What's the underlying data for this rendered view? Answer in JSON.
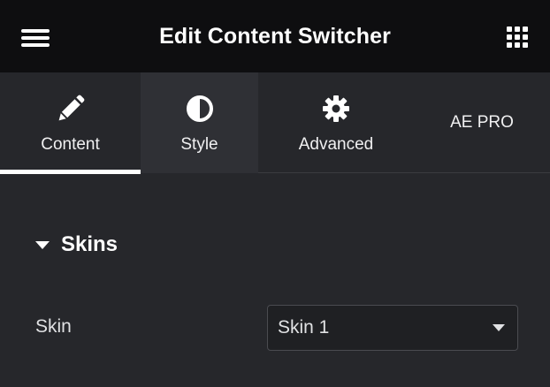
{
  "header": {
    "title": "Edit Content Switcher",
    "menu_icon": "hamburger-menu-icon",
    "apps_icon": "grid-apps-icon"
  },
  "tabs": [
    {
      "label": "Content",
      "icon": "pencil-icon",
      "active": true
    },
    {
      "label": "Style",
      "icon": "contrast-half-circle-icon",
      "active": false
    },
    {
      "label": "Advanced",
      "icon": "gear-icon",
      "active": false
    },
    {
      "label": "AE PRO",
      "icon": "",
      "active": false
    }
  ],
  "section": {
    "title": "Skins",
    "expanded": true
  },
  "controls": {
    "skin": {
      "label": "Skin",
      "value": "Skin 1"
    }
  },
  "colors": {
    "header_bg": "#0e0e10",
    "panel_bg": "#26272b",
    "active_indicator": "#ffffff",
    "hover_tab_bg": "#2f3035"
  }
}
